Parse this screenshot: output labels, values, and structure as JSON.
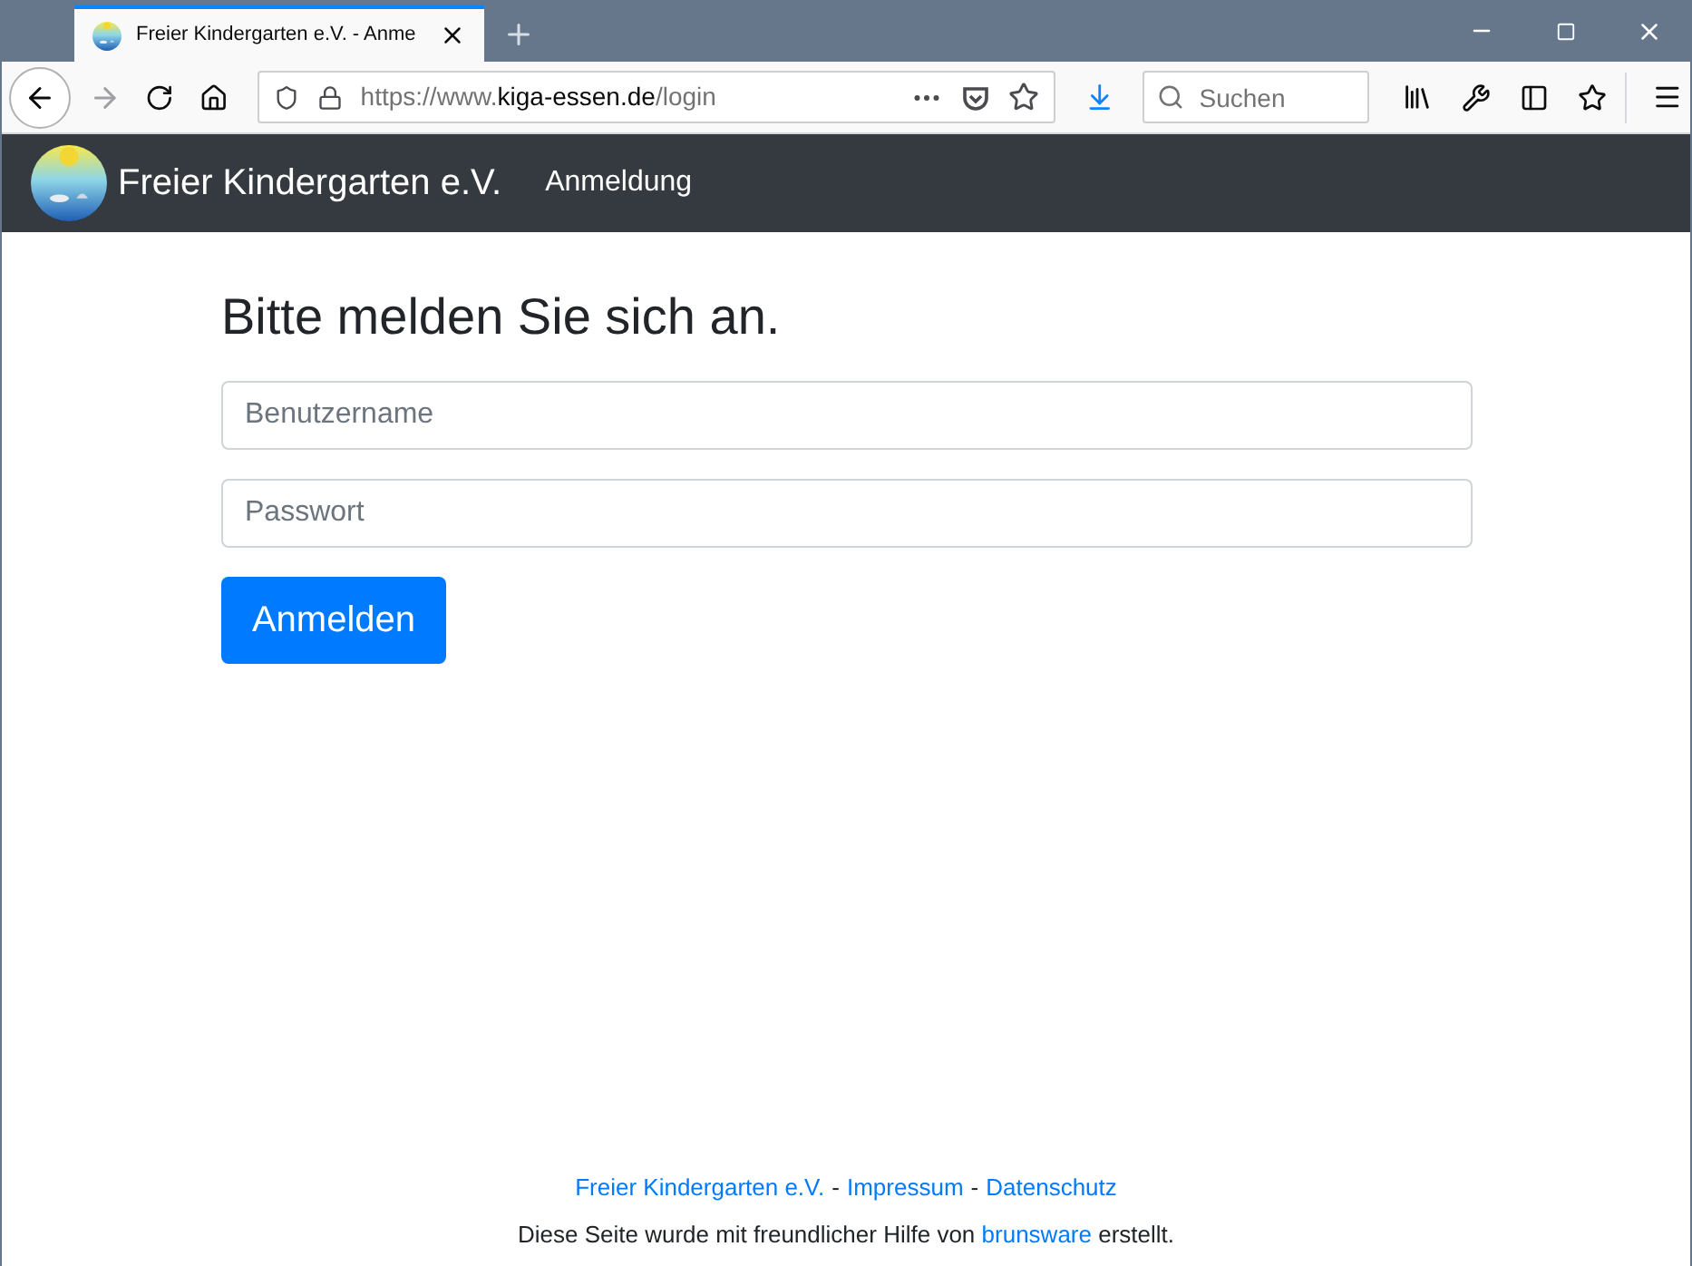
{
  "browser": {
    "tabs": [
      {
        "title": "Freier Kindergarten e.V. - Anme",
        "selected": true
      }
    ],
    "url": {
      "prefix": "https://www.",
      "domain": "kiga-essen.de",
      "path": "/login"
    },
    "search": {
      "placeholder": "Suchen"
    }
  },
  "navbar": {
    "brand": "Freier Kindergarten e.V.",
    "links": [
      {
        "label": "Anmeldung"
      }
    ]
  },
  "login": {
    "heading": "Bitte melden Sie sich an.",
    "fields": [
      {
        "placeholder": "Benutzername"
      },
      {
        "placeholder": "Passwort"
      }
    ],
    "button": "Anmelden"
  },
  "footer": {
    "links": [
      "Freier Kindergarten e.V.",
      "Impressum",
      "Datenschutz"
    ],
    "separator": "-",
    "credit": {
      "before": "Diese Seite wurde mit freundlicher Hilfe von",
      "link": "brunsware",
      "after": "erstellt."
    }
  }
}
